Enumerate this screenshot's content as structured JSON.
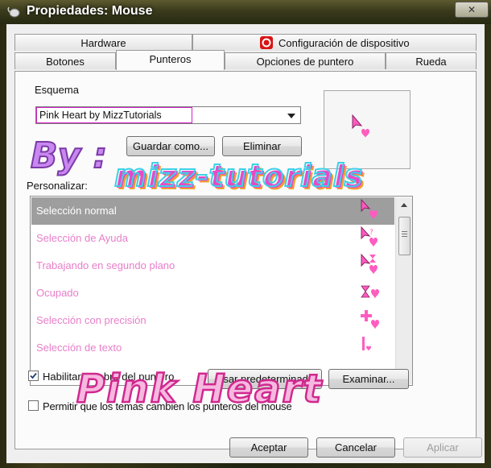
{
  "window": {
    "title": "Propiedades: Mouse",
    "close_label": "✕"
  },
  "tabs_row1": [
    {
      "label": "Hardware"
    },
    {
      "label": "Configuración de dispositivo"
    }
  ],
  "tabs_row2": [
    {
      "label": "Botones"
    },
    {
      "label": "Punteros",
      "selected": true
    },
    {
      "label": "Opciones de puntero"
    },
    {
      "label": "Rueda"
    }
  ],
  "scheme": {
    "label": "Esquema",
    "value": "Pink Heart by MizzTutorials",
    "save_label": "Guardar como...",
    "delete_label": "Eliminar"
  },
  "customize": {
    "label": "Personalizar:",
    "items": [
      {
        "label": "Selección normal",
        "selected": true,
        "icon": "arrow-heart-icon"
      },
      {
        "label": "Selección de Ayuda",
        "icon": "arrow-help-heart-icon"
      },
      {
        "label": "Trabajando en segundo plano",
        "icon": "arrow-hourglass-heart-icon"
      },
      {
        "label": "Ocupado",
        "icon": "hourglass-heart-icon"
      },
      {
        "label": "Selección con precisión",
        "icon": "crosshair-heart-icon"
      },
      {
        "label": "Selección de texto",
        "icon": "text-beam-heart-icon"
      }
    ]
  },
  "options": {
    "shadow_label": "Habilitar sombra del puntero",
    "shadow_checked": true,
    "default_label": "Usar predeterminado",
    "delete_label": "Examinar...",
    "themes_label": "Permitir que los temas cambien los punteros del mouse",
    "themes_checked": false
  },
  "dialog": {
    "ok": "Aceptar",
    "cancel": "Cancelar",
    "apply": "Aplicar"
  },
  "watermark": {
    "by": "By :",
    "brand": "mizz-tutorials",
    "title": "Pink Heart"
  },
  "colors": {
    "accent_pink": "#e87ec9",
    "heart": "#ff5cc0",
    "selection": "#9e9e9e"
  }
}
